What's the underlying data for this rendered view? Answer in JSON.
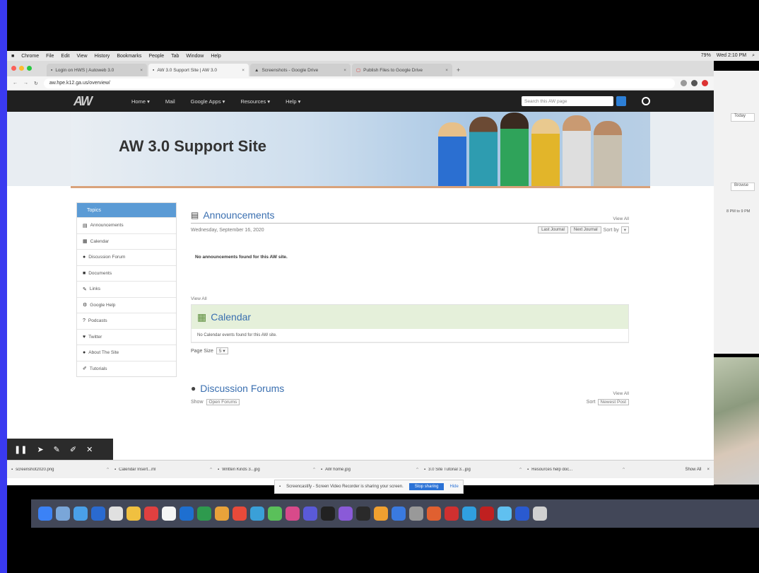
{
  "menubar": {
    "items": [
      "Chrome",
      "File",
      "Edit",
      "View",
      "History",
      "Bookmarks",
      "People",
      "Tab",
      "Window",
      "Help"
    ],
    "clock": "Wed 2:10 PM",
    "battery": "79%"
  },
  "browser": {
    "tabs": [
      {
        "label": "Login on HWS | Autoweb 3.0"
      },
      {
        "label": "AW 3.0 Support Site | AW 3.0"
      },
      {
        "label": "Screenshots - Google Drive"
      },
      {
        "label": "Publish Files to Google Drive"
      }
    ],
    "url": "aw.hpe.k12.ga.us/overview/"
  },
  "site": {
    "logo": "AW",
    "nav": [
      "Home ▾",
      "Mail",
      "Google Apps ▾",
      "Resources ▾",
      "Help ▾"
    ],
    "search_placeholder": "Search this AW page",
    "banner_title": "AW 3.0 Support Site"
  },
  "sidebar": {
    "header": "Topics",
    "items": [
      {
        "icon": "▤",
        "label": "Announcements"
      },
      {
        "icon": "▦",
        "label": "Calendar"
      },
      {
        "icon": "●",
        "label": "Discussion Forum"
      },
      {
        "icon": "■",
        "label": "Documents"
      },
      {
        "icon": "✎",
        "label": "Links"
      },
      {
        "icon": "⚙",
        "label": "Google Help"
      },
      {
        "icon": "?",
        "label": "Podcasts"
      },
      {
        "icon": "♥",
        "label": "Twitter"
      },
      {
        "icon": "●",
        "label": "About The Site"
      },
      {
        "icon": "✐",
        "label": "Tutorials"
      }
    ]
  },
  "announcements": {
    "title": "Announcements",
    "view_all": "View All",
    "date": "Wednesday, September 16, 2020",
    "btn_prev": "Last Journal",
    "btn_next": "Next Journal",
    "sort_label": "Sort by",
    "empty": "No announcements found for this AW site."
  },
  "calendar": {
    "view_all": "View All",
    "title": "Calendar",
    "empty": "No Calendar events found for this AW site.",
    "page_size_label": "Page Size",
    "page_size_value": "5"
  },
  "forums": {
    "title": "Discussion Forums",
    "view_all": "View All",
    "show_label": "Show",
    "show_value": "Open Forums",
    "sort_label": "Sort",
    "sort_value": "Newest Post"
  },
  "right_panel": {
    "button1": "Today",
    "button2": "Browse",
    "text": "8 PM to 9 PM"
  },
  "downloads": {
    "items": [
      "screenshot2020.png",
      "Calendar Insert...ml",
      "Written Kinds 3...jpg",
      "AW home.jpg",
      "3.0 Site Tutorial 3...jpg",
      "Resources help doc..."
    ],
    "show_all": "Show All"
  },
  "sharing": {
    "text": "Screencastify - Screen Video Recorder is sharing your screen.",
    "stop": "Stop sharing",
    "hide": "Hide"
  },
  "colors": {
    "frame": "#3a3af0",
    "accent": "#3a6fb0",
    "sidebar_head": "#5b9bd5",
    "calendar_head": "#e5f0da"
  }
}
